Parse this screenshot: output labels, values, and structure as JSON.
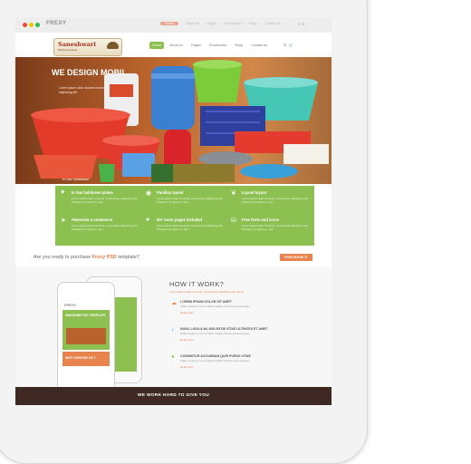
{
  "browser": {
    "logo": "FREXY",
    "nav": [
      "Home",
      "About us",
      "Pages",
      "Shortcodes",
      "Shop",
      "Contact us"
    ],
    "search_icon": "search-icon"
  },
  "header": {
    "logo_text": "Saneshwari",
    "logo_tag": "Plastic products",
    "nav": [
      "Home",
      "About us",
      "Pages",
      "Shortcodes",
      "Shop",
      "Contact us"
    ],
    "icons": [
      "search-icon",
      "cart-icon"
    ]
  },
  "hero": {
    "title": "WE DESIGN MOBIL",
    "subtitle": "Lorem ipsum dolor sit amet consectetur adipiscing elit",
    "caption": "In hac habitasse"
  },
  "features": [
    {
      "icon": "heart-icon",
      "title": "In hac habitasse plates",
      "desc": "Lorem ipsum dolor sit amet, consectetur adipiscing elit. Praesent ut metus ut, sem."
    },
    {
      "icon": "camera-icon",
      "title": "Parallax layout",
      "desc": "Lorem ipsum dolor sit amet, consectetur adipiscing elit. Praesent ut metus ut, sem."
    },
    {
      "icon": "leaf-icon",
      "title": "Layout layout",
      "desc": "Lorem ipsum dolor sit amet, consectetur adipiscing elit. Praesent ut metus ut, sem."
    },
    {
      "icon": "rocket-icon",
      "title": "Awesome e-commerce",
      "desc": "Lorem ipsum dolor sit amet, consectetur adipiscing elit. Praesent ut metus ut, sem."
    },
    {
      "icon": "apple-icon",
      "title": "50+ inner pages included",
      "desc": "Lorem ipsum dolor sit amet, consectetur adipiscing elit. Praesent ut metus ut, sem."
    },
    {
      "icon": "sitemap-icon",
      "title": "Free fonts and icons",
      "desc": "Lorem ipsum dolor sit amet, consectetur adipiscing elit. Praesent ut metus ut, sem."
    }
  ],
  "purchase": {
    "question_prefix": "Are you ready to purchase",
    "brand": "Frexy PSD",
    "question_suffix": "template?",
    "button": "PURCHASE IT"
  },
  "how": {
    "title": "HOW IT WORK?",
    "subtitle": "Lorem ipsum dolor sit amet, consectetur adipiscing elit mauris",
    "phone_title": "AWESOME PSD TEMPLATE",
    "phone_cta": "WHY CHOOSE US ?",
    "phone_logo": "FREXY",
    "steps": [
      {
        "icon": "download-icon",
        "title": "LOREM IPSUM DOLOR SIT AMET",
        "desc": "Nullam tempus ut enim et libero facilisis rhoncus pharetra augue",
        "more": "Read more"
      },
      {
        "icon": "mic-icon",
        "title": "NUNC LIGULA MI, MOLESTIE VITAE ULTRICES ET AMET",
        "desc": "Nullam tempus ut enim et libero facilisis rhoncus pharetra augue",
        "more": "Read more"
      },
      {
        "icon": "drop-icon",
        "title": "CURABITUR ACCUMSAN QUIS PURUS VITAE",
        "desc": "Nullam tempus ut enim et libero facilisis rhoncus pharetra augue",
        "more": "Read more"
      }
    ]
  },
  "bottom": {
    "title": "WE WORK HARD TO GIVE YOU"
  },
  "colors": {
    "accent_green": "#8cc152",
    "accent_orange": "#e8834e",
    "dark": "#3e2a22"
  }
}
